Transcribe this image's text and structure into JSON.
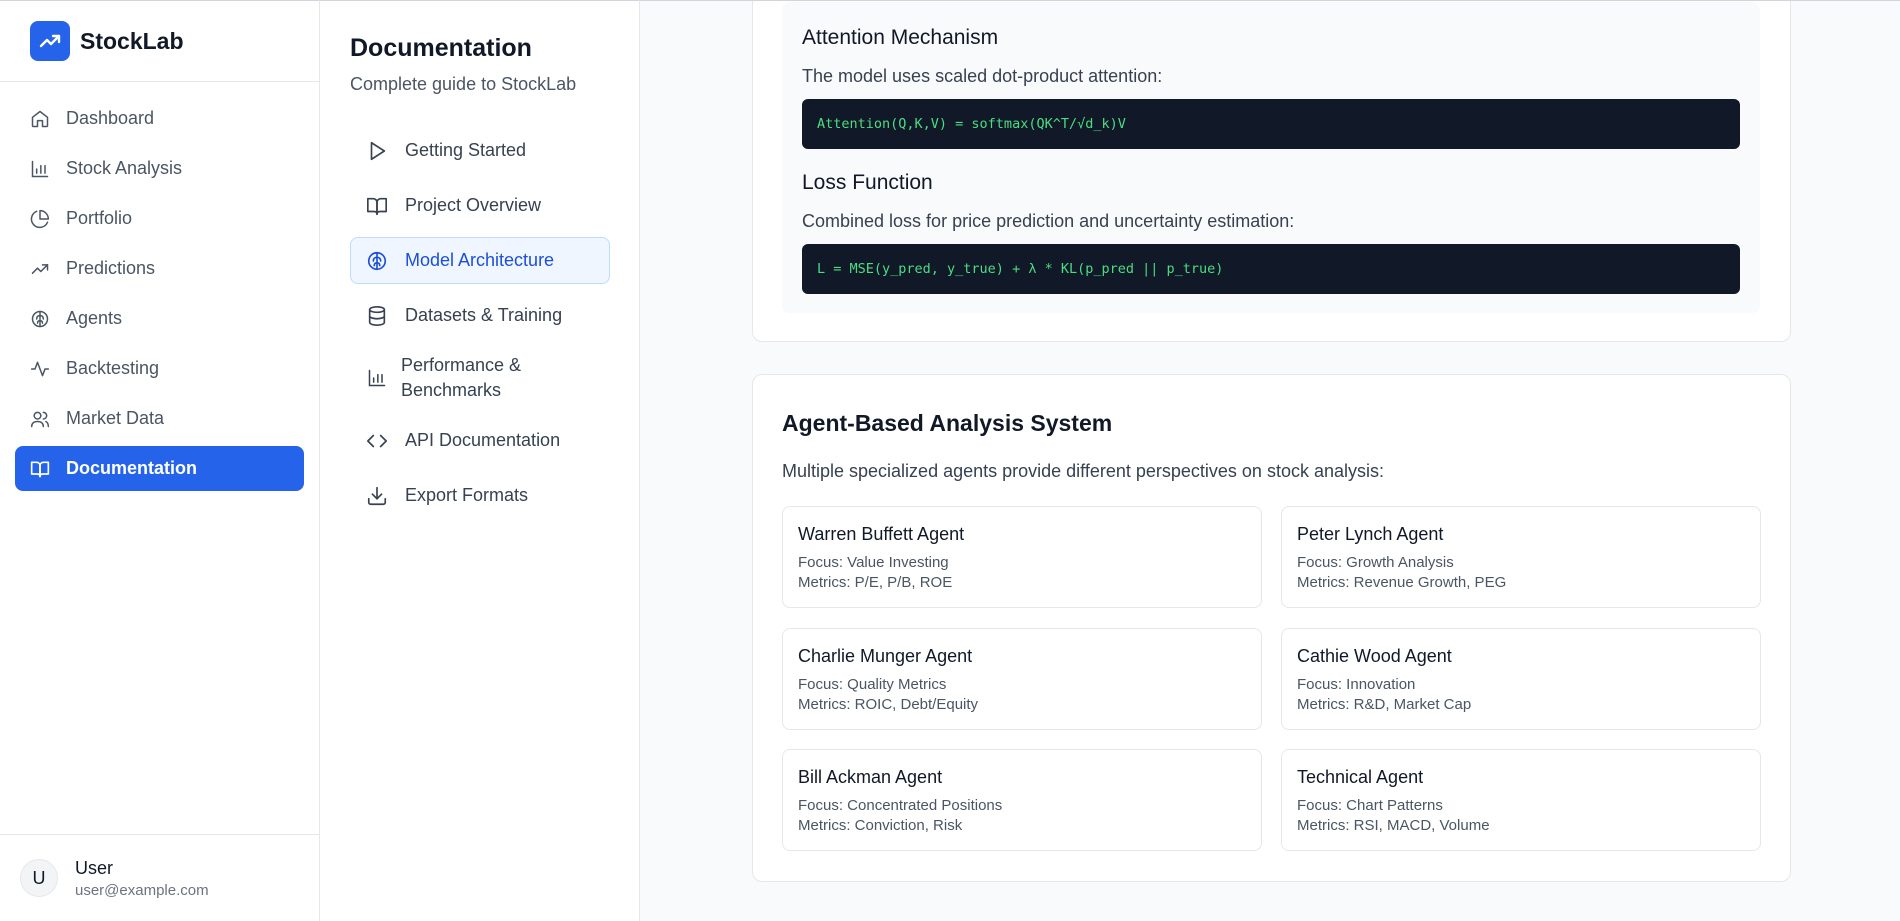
{
  "app": {
    "name": "StockLab"
  },
  "nav": {
    "items": [
      {
        "label": "Dashboard",
        "icon": "home-icon"
      },
      {
        "label": "Stock Analysis",
        "icon": "bar-chart-icon"
      },
      {
        "label": "Portfolio",
        "icon": "pie-chart-icon"
      },
      {
        "label": "Predictions",
        "icon": "trending-up-icon"
      },
      {
        "label": "Agents",
        "icon": "brain-icon"
      },
      {
        "label": "Backtesting",
        "icon": "activity-icon"
      },
      {
        "label": "Market Data",
        "icon": "users-icon"
      },
      {
        "label": "Documentation",
        "icon": "book-icon",
        "active": true
      }
    ]
  },
  "user": {
    "initial": "U",
    "name": "User",
    "email": "user@example.com"
  },
  "docs": {
    "title": "Documentation",
    "subtitle": "Complete guide to StockLab",
    "items": [
      {
        "label": "Getting Started",
        "icon": "play-icon"
      },
      {
        "label": "Project Overview",
        "icon": "book-open-icon"
      },
      {
        "label": "Model Architecture",
        "icon": "brain-icon",
        "active": true
      },
      {
        "label": "Datasets & Training",
        "icon": "database-icon"
      },
      {
        "label": "Performance & Benchmarks",
        "icon": "bar-chart-icon"
      },
      {
        "label": "API Documentation",
        "icon": "code-icon"
      },
      {
        "label": "Export Formats",
        "icon": "download-icon"
      }
    ]
  },
  "content": {
    "attention": {
      "title": "Attention Mechanism",
      "text": "The model uses scaled dot-product attention:",
      "code": "Attention(Q,K,V) = softmax(QK^T/√d_k)V"
    },
    "loss": {
      "title": "Loss Function",
      "text": "Combined loss for price prediction and uncertainty estimation:",
      "code": "L = MSE(y_pred, y_true) + λ * KL(p_pred || p_true)"
    },
    "agents": {
      "title": "Agent-Based Analysis System",
      "description": "Multiple specialized agents provide different perspectives on stock analysis:",
      "list": [
        {
          "name": "Warren Buffett Agent",
          "focus": "Focus: Value Investing",
          "metrics": "Metrics: P/E, P/B, ROE"
        },
        {
          "name": "Peter Lynch Agent",
          "focus": "Focus: Growth Analysis",
          "metrics": "Metrics: Revenue Growth, PEG"
        },
        {
          "name": "Charlie Munger Agent",
          "focus": "Focus: Quality Metrics",
          "metrics": "Metrics: ROIC, Debt/Equity"
        },
        {
          "name": "Cathie Wood Agent",
          "focus": "Focus: Innovation",
          "metrics": "Metrics: R&D, Market Cap"
        },
        {
          "name": "Bill Ackman Agent",
          "focus": "Focus: Concentrated Positions",
          "metrics": "Metrics: Conviction, Risk"
        },
        {
          "name": "Technical Agent",
          "focus": "Focus: Chart Patterns",
          "metrics": "Metrics: RSI, MACD, Volume"
        }
      ]
    }
  },
  "colors": {
    "accent": "#2563eb",
    "code_bg": "#111827",
    "code_text": "#4ade80"
  }
}
